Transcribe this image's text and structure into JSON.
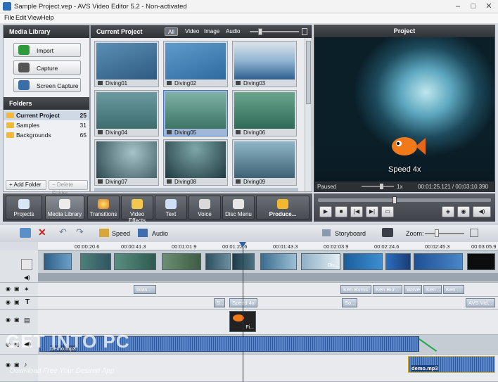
{
  "window": {
    "title": "Sample Project.vep - AVS Video Editor 5.2 - Non-activated"
  },
  "menu": [
    "File",
    "Edit",
    "View",
    "Help"
  ],
  "library": {
    "title": "Media Library",
    "buttons": [
      "Import",
      "Capture",
      "Screen Capture"
    ]
  },
  "folders": {
    "title": "Folders",
    "items": [
      {
        "name": "Current Project",
        "count": "25"
      },
      {
        "name": "Samples",
        "count": "31"
      },
      {
        "name": "Backgrounds",
        "count": "65"
      }
    ],
    "add": "+ Add Folder",
    "delete": "− Delete Folder"
  },
  "project": {
    "title": "Current Project",
    "filters": [
      "All",
      "Video",
      "Image",
      "Audio"
    ],
    "clips": [
      "Diving01",
      "Diving02",
      "Diving03",
      "Diving04",
      "Diving05",
      "Diving06",
      "Diving07",
      "Diving08",
      "Diving09"
    ],
    "selected": "Diving05"
  },
  "preview": {
    "title": "Project",
    "overlay": "Speed 4x",
    "status": "Paused",
    "speed": "1x",
    "time": "00:01:25.121 / 00:03:10.390"
  },
  "toolbar": [
    "Projects",
    "Media Library",
    "Transitions",
    "Video Effects",
    "Text",
    "Voice",
    "Disc Menu",
    "Produce..."
  ],
  "timeline": {
    "speed": "Speed",
    "audio": "Audio",
    "storyboard": "Storyboard",
    "zoom": "Zoom:",
    "ticks": [
      "00:00:20.6",
      "00:00:41.3",
      "00:01:01.9",
      "00:01:22.6",
      "00:01:43.3",
      "00:02:03.9",
      "00:02:24.6",
      "00:02:45.3",
      "00:03:05.9"
    ],
    "video_clip_labels": [
      "Div..."
    ],
    "effects": [
      "Glas...",
      "Ken Burns",
      "Ken Bur...",
      "Wave",
      "Ken ...",
      "Ken ..."
    ],
    "texts": [
      "S...",
      "Speed 4x",
      "So...",
      "AVS Vid..."
    ],
    "overlay_clip": "Fi...",
    "audio1": "Demo.mp3",
    "audio2": "demo.mp3"
  },
  "watermark": {
    "title": "GET INTO PC",
    "subtitle": "Download Free Your Desired App"
  }
}
